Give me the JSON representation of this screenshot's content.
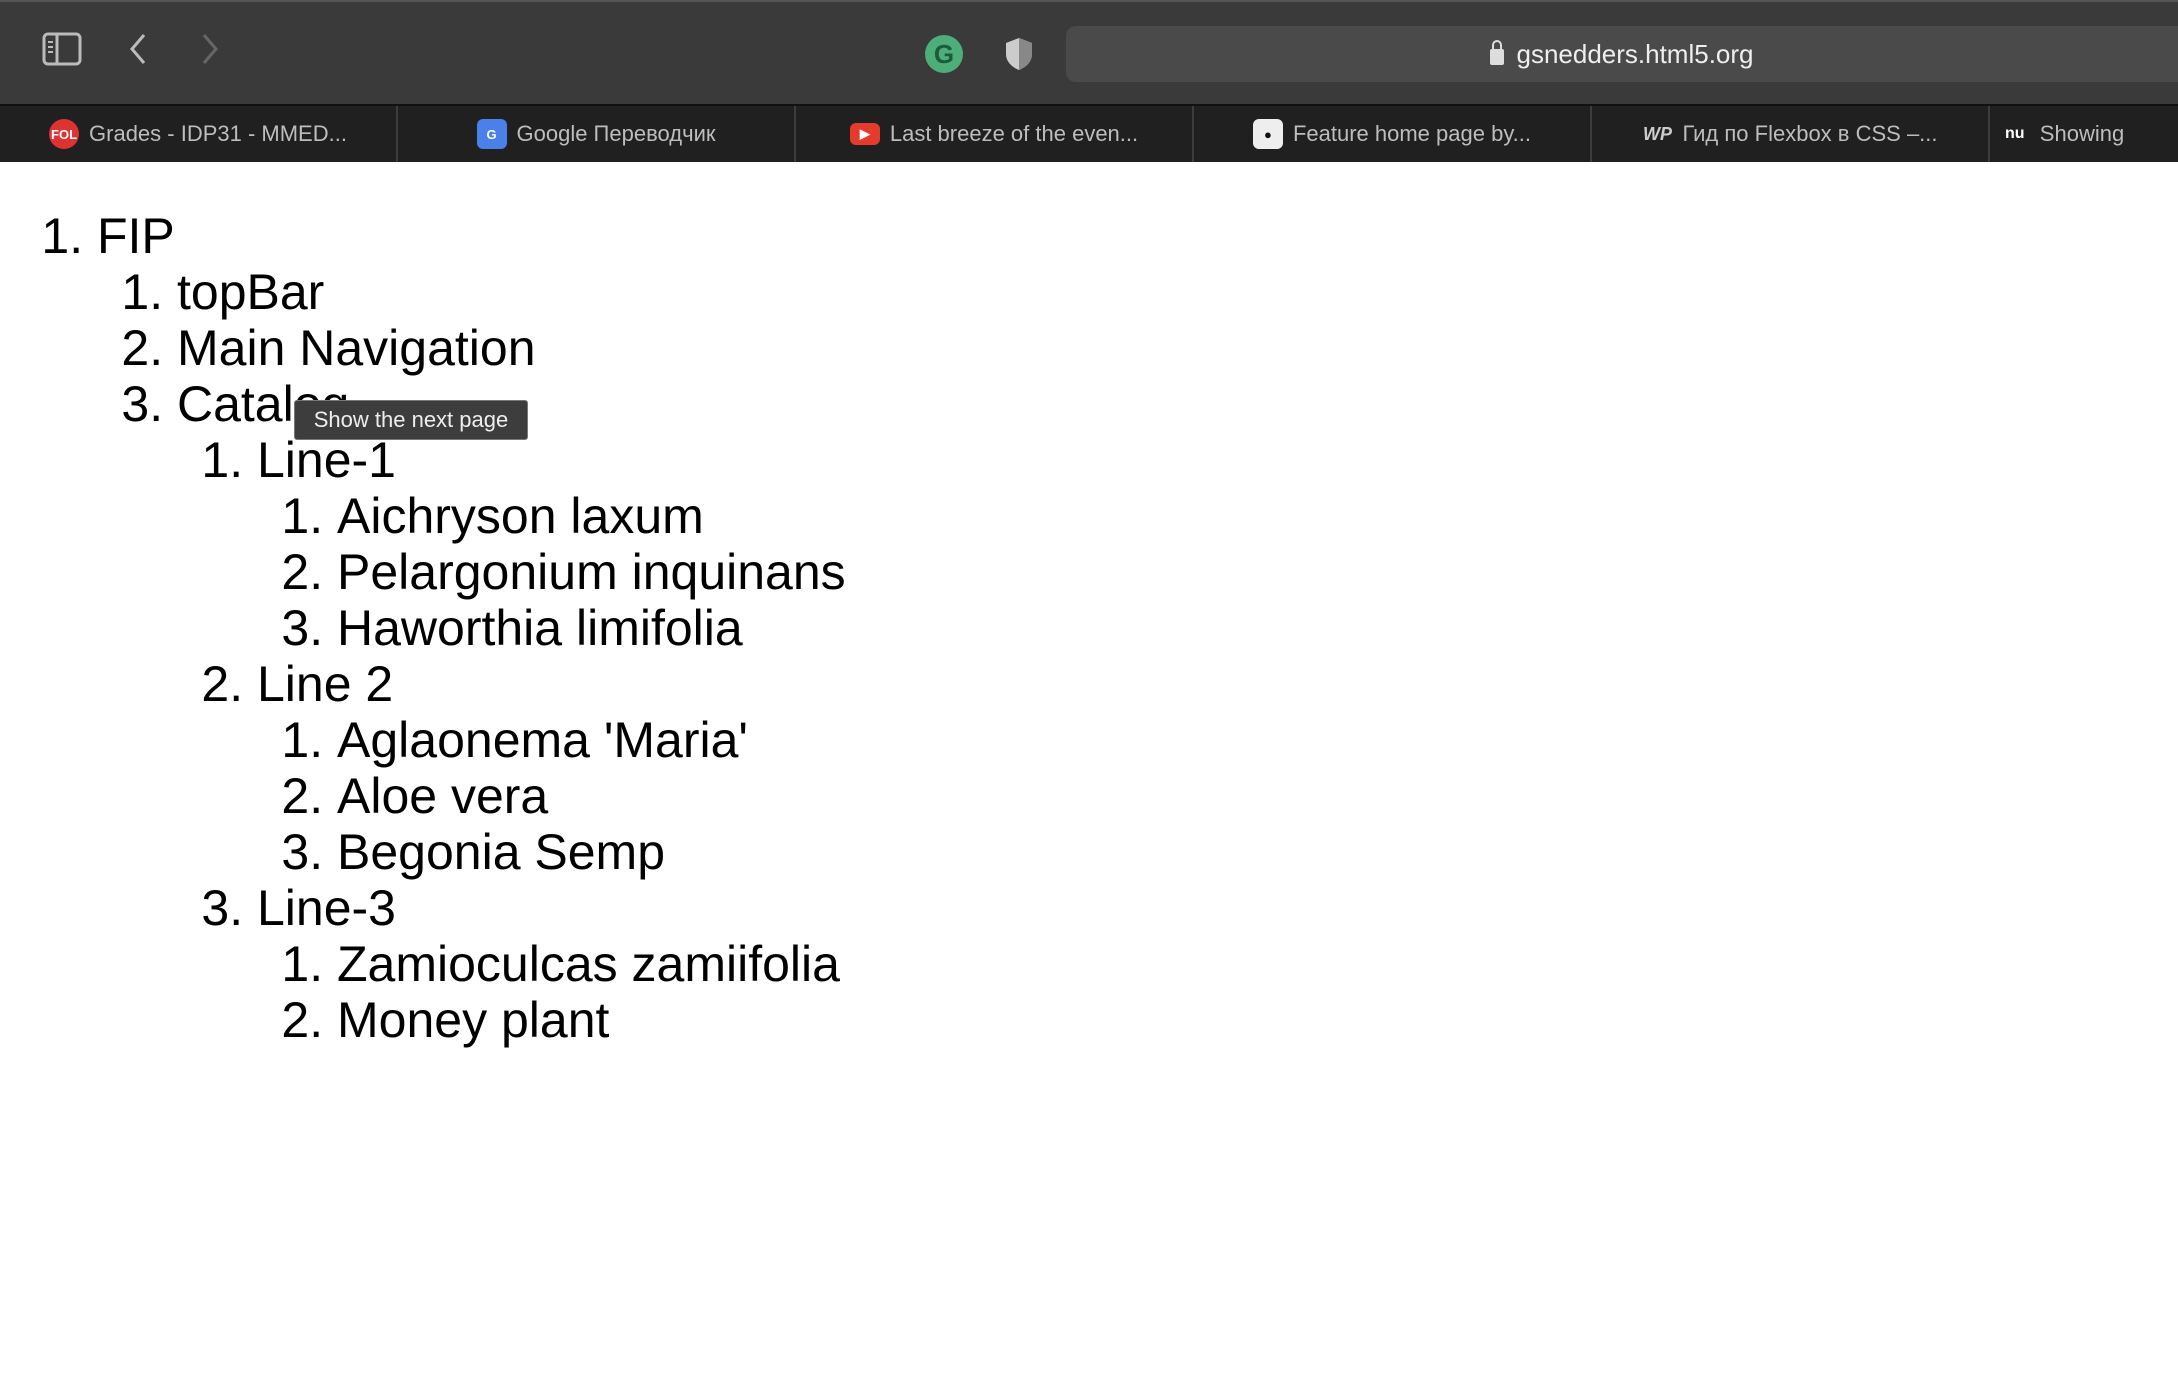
{
  "browser": {
    "url": "gsnedders.html5.org",
    "accent_extension": "#4caf7a",
    "tabs": [
      {
        "label": "Grades - IDP31 - MMED...",
        "icon": "fol-icon"
      },
      {
        "label": "Google Переводчик",
        "icon": "google-translate-icon"
      },
      {
        "label": "Last breeze of the even...",
        "icon": "youtube-icon"
      },
      {
        "label": "Feature home page by...",
        "icon": "github-icon"
      },
      {
        "label": "Гид по Flexbox в CSS –...",
        "icon": "wp-icon"
      },
      {
        "label": "Showing",
        "icon": "nu-icon"
      }
    ]
  },
  "tooltip": "Show the next page",
  "outline": {
    "root": "FIP",
    "items": [
      "topBar",
      "Main Navigation",
      "Catalog"
    ],
    "lines": [
      {
        "label": "Line-1",
        "plants": [
          "Aichryson laxum",
          "Pelargonium inquinans",
          "Haworthia limifolia"
        ]
      },
      {
        "label": "Line 2",
        "plants": [
          "Aglaonema 'Maria'",
          "Aloe vera",
          "Begonia Semp"
        ]
      },
      {
        "label": "Line-3",
        "plants": [
          "Zamioculcas zamiifolia",
          "Money plant"
        ]
      }
    ]
  }
}
